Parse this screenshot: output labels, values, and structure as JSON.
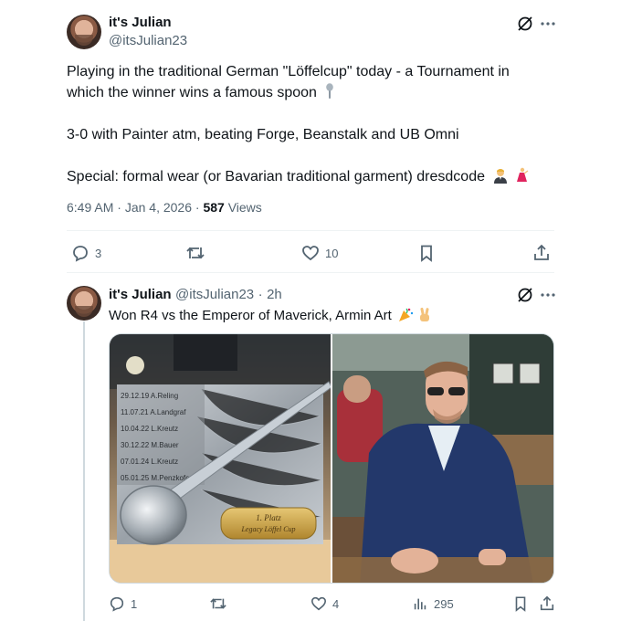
{
  "main_tweet": {
    "author_name": "it's Julian",
    "handle": "@itsJulian23",
    "text_line1": "Playing in the traditional German \"Löffelcup\" today - a Tournament in",
    "text_line2": "which the winner wins a famous spoon",
    "text_line3": "3-0 with Painter atm, beating Forge, Beanstalk and UB Omni",
    "text_line4": "Special: formal wear (or Bavarian traditional garment) dresdcode",
    "time": "6:49 AM",
    "date": "Jan 4, 2026",
    "views_count": "587",
    "views_label": "Views",
    "replies": "3",
    "likes": "10"
  },
  "reply_tweet": {
    "author_name": "it's Julian",
    "handle": "@itsJulian23",
    "age": "2h",
    "text": "Won R4 vs the Emperor of Maverick, Armin Art",
    "replies": "1",
    "likes": "4",
    "views": "295"
  },
  "trophy_image": {
    "plaque_entries": [
      "29.12.19 A.Reling",
      "11.07.21 A.Landgraf",
      "10.04.22 L.Kreutz",
      "30.12.22 M.Bauer",
      "07.01.24 L.Kreutz",
      "05.01.25 M.Penzkofer"
    ],
    "plate_line1": "1. Platz",
    "plate_line2": "Legacy Löffel Cup"
  },
  "icons": {
    "grok": "grok-icon",
    "more": "more-icon",
    "reply": "reply-icon",
    "retweet": "retweet-icon",
    "like": "heart-icon",
    "bookmark": "bookmark-icon",
    "share": "share-icon",
    "views": "views-icon"
  },
  "colors": {
    "text": "#0f1419",
    "muted": "#536471",
    "divider": "#eff3f4",
    "blazer": "#23386b"
  }
}
